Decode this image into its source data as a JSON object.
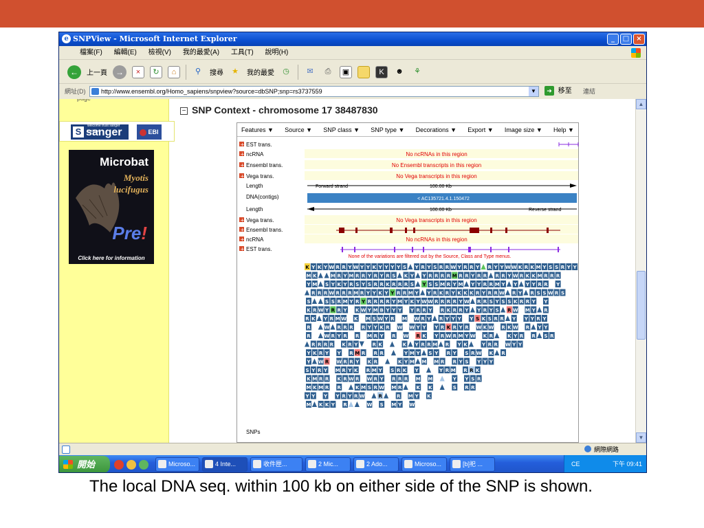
{
  "window": {
    "title": "SNPView - Microsoft Internet Explorer",
    "buttons": {
      "minimize": "_",
      "maximize": "□",
      "close": "×"
    }
  },
  "menu": [
    "檔案(F)",
    "編輯(E)",
    "檢視(V)",
    "我的最愛(A)",
    "工具(T)",
    "說明(H)"
  ],
  "toolbar": {
    "back_label": "上一頁",
    "search_label": "搜尋",
    "favorites_label": "我的最愛"
  },
  "address": {
    "label": "網址(D)",
    "url": "http://www.ensembl.org/Homo_sapiens/snpview?source=dbSNP;snp=rs3737559",
    "go_label": "移至",
    "links_label": "連結"
  },
  "sidebar": {
    "page_fragment": "page",
    "sanger_tagline": "welcome trust sanger institute",
    "sanger_logo": "sanger",
    "ebi_logo": "EBI",
    "ad": {
      "title": "Microbat",
      "species_line1": "Myotis",
      "species_line2": "lucifugus",
      "pre": "Pre",
      "bang": "!",
      "info": "Click here for information"
    }
  },
  "snp_context": {
    "title": "SNP Context - chromosome 17 38487830",
    "collapse_symbol": "−",
    "menu": [
      "Features ▼",
      "Source ▼",
      "SNP class ▼",
      "SNP type ▼",
      "Decorations ▼",
      "Export ▼",
      "Image size ▼",
      "Help ▼"
    ],
    "tracks": [
      {
        "label": "EST trans.",
        "expandable": true,
        "message": ""
      },
      {
        "label": "ncRNA",
        "expandable": true,
        "message": "No ncRNAs in this region"
      },
      {
        "label": "Ensembl trans.",
        "expandable": true,
        "message": "No Ensembl transcripts in this region"
      },
      {
        "label": "Vega trans.",
        "expandable": true,
        "message": "No Vega transcripts in this region"
      },
      {
        "label": "Length",
        "expandable": false,
        "message": ""
      },
      {
        "label": "DNA(contigs)",
        "expandable": false,
        "message": ""
      },
      {
        "label": "Length",
        "expandable": false,
        "message": ""
      },
      {
        "label": "Vega trans.",
        "expandable": true,
        "message": "No Vega transcripts in this region"
      },
      {
        "label": "Ensembl trans.",
        "expandable": true,
        "message": ""
      },
      {
        "label": "ncRNA",
        "expandable": true,
        "message": "No ncRNAs in this region"
      },
      {
        "label": "EST trans.",
        "expandable": true,
        "message": ""
      },
      {
        "label": "SNPs",
        "expandable": false,
        "message": ""
      }
    ],
    "forward_strand": "Forward strand",
    "reverse_strand": "Reverse strand",
    "scale_label": "100.00 Kb",
    "contig_label": "< AC135721.4.1.150472",
    "filter_notice": "None of the variations are filtered out by the Source, Class and Type menus."
  },
  "snp_rows": [
    "KYKYWRRYWYYKYYYYSAYRYSRRWYRRYARYYWWKRKMYSSRYY",
    "MKAAMRYMRRYRYRSAKYAYRRRRMRRYRRARRYWRKKMRRR",
    "YMASYKYRSYSRRKRRRSAYSSMRYMAYYRRMYAYAYYRR Y",
    "ARRRWRRRMRYYKYYRRMYAYRKRYKKKRYRRWARYARSSWRS",
    "SAASSRMYRYRRRRYMYKYWWRRRRYWARRSYSSKRRY Y",
    "KRWYRRY KWYMBYYY YRRY RKRRYAYRYSARW MYAR",
    "RKAYRMW K MSWYR M WRYARYYY YSKSRRAY YYRY",
    "R AWARRR RYYKR W WYY YRKRYR WKW RKW RAYY",
    "R AWRYR R MRY R W RK YRWRMYW KRA KYR RASR",
    "ARRRR KRYV RK A KAYRRMAR YKA YRR WYY",
    "YKRY Y RMR RR A YMYASY RY SRW KAR",
    "YAWR WRRY KR A KYMAM MR RYS YYY",
    "SYRY MRYK RMY SRK Y A YRM RRK",
    "KMRR KRWR WRY RRR M M A Y YSR",
    "MKMR R AKMSRW MRA K K A S RR",
    "YY Y YRYRW ARA R MY K",
    "MAKKY RAA W S MY W"
  ],
  "status": {
    "zone_label": "網際網路"
  },
  "taskbar": {
    "start_label": "開始",
    "tasks": [
      "Microso...",
      "4 Inte...",
      "收件匣...",
      "2 Mic...",
      "2 Ado...",
      "Microso...",
      "[b]祀 ..."
    ],
    "tray_text": "CE",
    "time": "下午 09:41"
  },
  "caption": "The local DNA seq. within 100 kb on either side of the SNP is shown.",
  "colors": {
    "slide_bar": "#d0502f",
    "sidebar_bg": "#ffff99",
    "snp_box": "#2f5f8f",
    "contig_blue": "#3b82c4",
    "message_red": "#e00000",
    "vega_transcript": "#8b0000",
    "est_transcript": "#8a2be2"
  }
}
